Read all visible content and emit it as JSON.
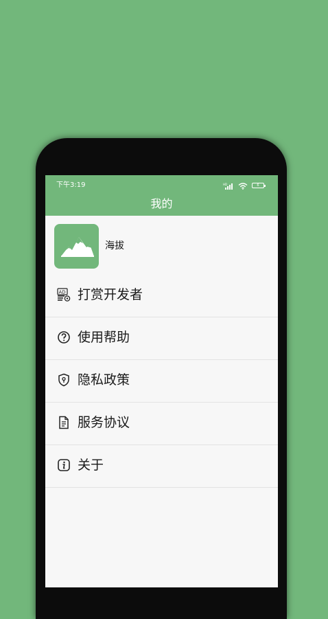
{
  "colors": {
    "accent": "#72b77b",
    "background": "#f7f7f7",
    "text": "#1a1a1a"
  },
  "status_bar": {
    "time": "下午3:19",
    "network_label": "HD",
    "battery_level": "6"
  },
  "header": {
    "title": "我的"
  },
  "profile": {
    "app_name": "海拔",
    "logo_icon": "mountain-icon"
  },
  "menu": {
    "items": [
      {
        "label": "打赏开发者",
        "icon": "ad-icon"
      },
      {
        "label": "使用帮助",
        "icon": "help-icon"
      },
      {
        "label": "隐私政策",
        "icon": "shield-icon"
      },
      {
        "label": "服务协议",
        "icon": "document-icon"
      },
      {
        "label": "关于",
        "icon": "info-icon"
      }
    ]
  }
}
